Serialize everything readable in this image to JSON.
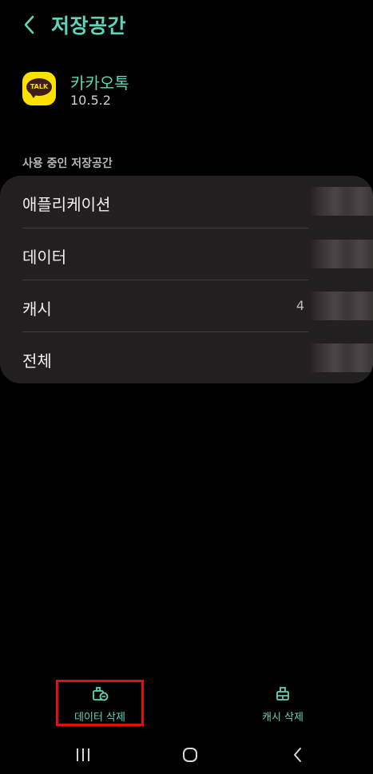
{
  "header": {
    "title": "저장공간",
    "back_icon": "chevron-left-icon"
  },
  "app": {
    "name": "카카오톡",
    "version": "10.5.2",
    "icon_text": "TALK"
  },
  "storage": {
    "section_title": "사용 중인 저장공간",
    "rows": [
      {
        "label": "애플리케이션",
        "value": ""
      },
      {
        "label": "데이터",
        "value": ""
      },
      {
        "label": "캐시",
        "value": "4"
      },
      {
        "label": "전체",
        "value": ""
      }
    ]
  },
  "actions": {
    "clear_data": {
      "label": "데이터 삭제",
      "icon": "clear-data-icon"
    },
    "clear_cache": {
      "label": "캐시 삭제",
      "icon": "clear-cache-icon"
    }
  },
  "colors": {
    "accent": "#5fd6ba",
    "card": "#231e1f",
    "highlight": "#e01010",
    "kakao_yellow": "#fae100"
  }
}
